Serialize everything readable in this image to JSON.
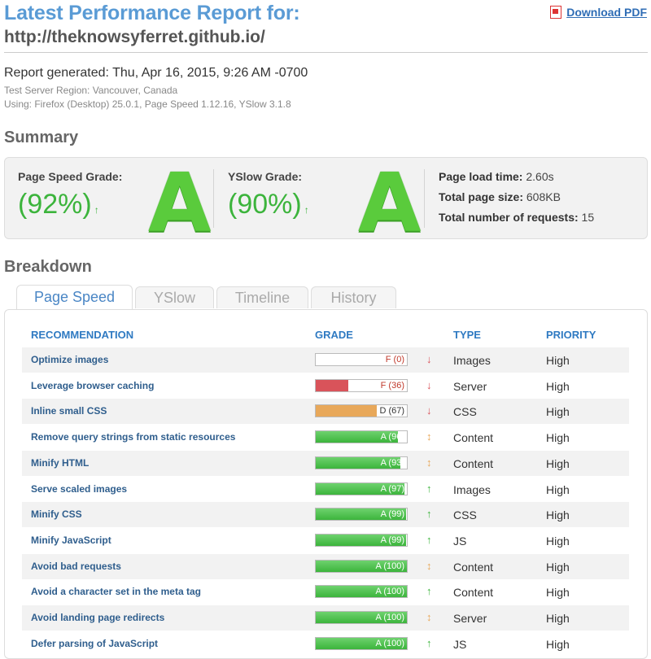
{
  "header": {
    "title": "Latest Performance Report for:",
    "url": "http://theknowsyferret.github.io/",
    "download_label": "Download PDF"
  },
  "meta": {
    "generated": "Report generated: Thu, Apr 16, 2015, 9:26 AM -0700",
    "region": "Test Server Region: Vancouver, Canada",
    "using": "Using: Firefox (Desktop) 25.0.1, Page Speed 1.12.16, YSlow 3.1.8"
  },
  "summary": {
    "heading": "Summary",
    "pagespeed_label": "Page Speed Grade:",
    "pagespeed_pct": "(92%)",
    "pagespeed_letter": "A",
    "yslow_label": "YSlow Grade:",
    "yslow_pct": "(90%)",
    "yslow_letter": "A",
    "load_time_label": "Page load time:",
    "load_time": "2.60s",
    "page_size_label": "Total page size:",
    "page_size": "608KB",
    "requests_label": "Total number of requests:",
    "requests": "15",
    "up_arrow": "↑"
  },
  "breakdown": {
    "heading": "Breakdown",
    "tabs": [
      "Page Speed",
      "YSlow",
      "Timeline",
      "History"
    ],
    "columns": {
      "recommendation": "RECOMMENDATION",
      "grade": "GRADE",
      "type": "TYPE",
      "priority": "PRIORITY"
    },
    "rows": [
      {
        "name": "Optimize images",
        "grade": "F (0)",
        "score": 0,
        "arrow": "↓",
        "type": "Images",
        "priority": "High"
      },
      {
        "name": "Leverage browser caching",
        "grade": "F (36)",
        "score": 36,
        "arrow": "↓",
        "type": "Server",
        "priority": "High"
      },
      {
        "name": "Inline small CSS",
        "grade": "D (67)",
        "score": 67,
        "arrow": "↓",
        "type": "CSS",
        "priority": "High"
      },
      {
        "name": "Remove query strings from static resources",
        "grade": "A (96)",
        "score": 90,
        "arrow": "↕",
        "type": "Content",
        "priority": "High"
      },
      {
        "name": "Minify HTML",
        "grade": "A (93)",
        "score": 93,
        "arrow": "↕",
        "type": "Content",
        "priority": "High"
      },
      {
        "name": "Serve scaled images",
        "grade": "A (97)",
        "score": 97,
        "arrow": "↑",
        "type": "Images",
        "priority": "High"
      },
      {
        "name": "Minify CSS",
        "grade": "A (99)",
        "score": 99,
        "arrow": "↑",
        "type": "CSS",
        "priority": "High"
      },
      {
        "name": "Minify JavaScript",
        "grade": "A (99)",
        "score": 99,
        "arrow": "↑",
        "type": "JS",
        "priority": "High"
      },
      {
        "name": "Avoid bad requests",
        "grade": "A (100)",
        "score": 100,
        "arrow": "↕",
        "type": "Content",
        "priority": "High"
      },
      {
        "name": "Avoid a character set in the meta tag",
        "grade": "A (100)",
        "score": 100,
        "arrow": "↑",
        "type": "Content",
        "priority": "High"
      },
      {
        "name": "Avoid landing page redirects",
        "grade": "A (100)",
        "score": 100,
        "arrow": "↕",
        "type": "Server",
        "priority": "High"
      },
      {
        "name": "Defer parsing of JavaScript",
        "grade": "A (100)",
        "score": 100,
        "arrow": "↑",
        "type": "JS",
        "priority": "High"
      }
    ]
  },
  "colors": {
    "grade_a": "#3cb43c",
    "grade_d": "#e8a85a",
    "grade_f": "#d9535a",
    "link": "#2f7ac2"
  }
}
